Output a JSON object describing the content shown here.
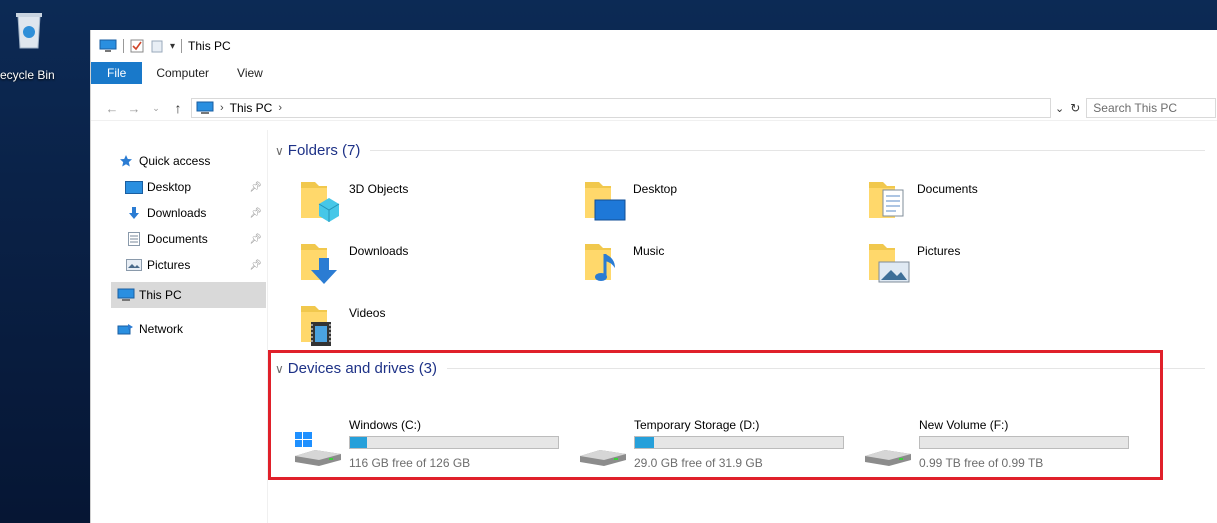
{
  "desktop": {
    "recycle_bin_label": "ecycle Bin"
  },
  "window": {
    "title": "This PC",
    "ribbon_tabs": [
      "File",
      "Computer",
      "View"
    ],
    "address": {
      "location": "This PC",
      "search_placeholder": "Search This PC"
    }
  },
  "navpane": {
    "items": [
      {
        "label": "Quick access",
        "icon": "star-icon"
      },
      {
        "label": "Desktop",
        "icon": "desktop-icon",
        "pinned": true
      },
      {
        "label": "Downloads",
        "icon": "download-arrow-icon",
        "pinned": true
      },
      {
        "label": "Documents",
        "icon": "document-icon",
        "pinned": true
      },
      {
        "label": "Pictures",
        "icon": "pictures-icon",
        "pinned": true
      },
      {
        "label": "This PC",
        "icon": "computer-icon",
        "selected": true
      },
      {
        "label": "Network",
        "icon": "network-icon"
      }
    ]
  },
  "folders": {
    "header": "Folders (7)",
    "items": [
      "3D Objects",
      "Desktop",
      "Documents",
      "Downloads",
      "Music",
      "Pictures",
      "Videos"
    ]
  },
  "drives": {
    "header": "Devices and drives (3)",
    "items": [
      {
        "name": "Windows (C:)",
        "free_text": "116 GB free of 126 GB",
        "used_fraction": 0.08
      },
      {
        "name": "Temporary Storage (D:)",
        "free_text": "29.0 GB free of 31.9 GB",
        "used_fraction": 0.09
      },
      {
        "name": "New Volume (F:)",
        "free_text": "0.99 TB free of 0.99 TB",
        "used_fraction": 0.0
      }
    ]
  },
  "colors": {
    "accent": "#1979ca",
    "bar_fill": "#26a0da",
    "highlight": "#e0202a",
    "group_header": "#1e3287"
  }
}
